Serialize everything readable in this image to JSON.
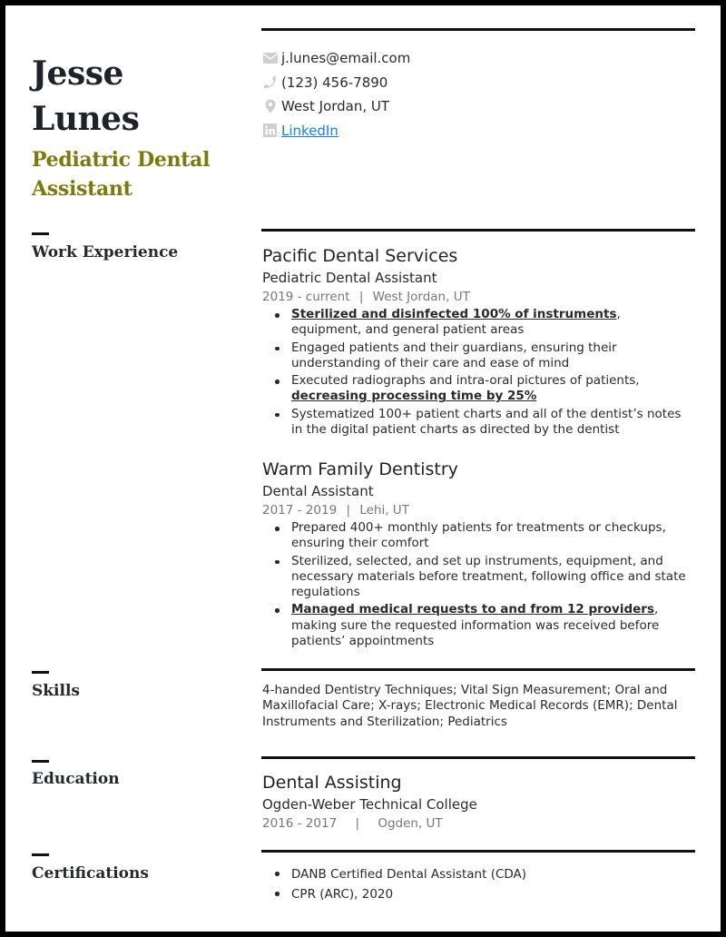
{
  "header": {
    "first_name": "Jesse",
    "last_name": "Lunes",
    "title_line1": "Pediatric Dental",
    "title_line2": "Assistant",
    "accent_color": "#7c7a0f"
  },
  "contact": {
    "email": "j.lunes@email.com",
    "phone": "(123) 456-7890",
    "location": "West Jordan, UT",
    "linkedin_label": "LinkedIn",
    "icons": [
      "envelope-icon",
      "phone-icon",
      "map-pin-icon",
      "linkedin-icon"
    ]
  },
  "sections": {
    "work": "Work Experience",
    "skills": "Skills",
    "education": "Education",
    "certifications": "Certifications"
  },
  "work": [
    {
      "company": "Pacific Dental Services",
      "role": "Pediatric Dental Assistant",
      "dates": "2019 - current",
      "location": "West Jordan, UT",
      "bullets": [
        {
          "highlight": "Sterilized and disinfected 100% of instruments",
          "text": ", equipment, and general patient areas"
        },
        {
          "pre": "Engaged patients and their guardians, ensuring their understanding of their care and ease of mind"
        },
        {
          "pre": "Executed radiographs and intra-oral pictures of patients, ",
          "highlight": "decreasing processing time by 25%"
        },
        {
          "pre": "Systematized 100+ patient charts and all of the dentist’s notes in the digital patient charts as directed by the dentist"
        }
      ]
    },
    {
      "company": "Warm Family Dentistry",
      "role": "Dental Assistant",
      "dates": "2017 - 2019",
      "location": "Lehi, UT",
      "bullets": [
        {
          "pre": "Prepared 400+ monthly patients for treatments or checkups, ensuring their comfort"
        },
        {
          "pre": "Sterilized, selected, and set up instruments, equipment, and necessary materials before treatment, following office and state regulations"
        },
        {
          "highlight": "Managed medical requests to and from 12 providers",
          "text": ", making sure the requested information was received before patients’ appointments"
        }
      ]
    }
  ],
  "skills": "4-handed Dentistry Techniques; Vital Sign Measurement; Oral and Maxillofacial Care; X-rays; Electronic Medical Records (EMR); Dental Instruments and Sterilization; Pediatrics",
  "education": {
    "degree": "Dental Assisting",
    "school": "Ogden-Weber Technical College",
    "dates": "2016 - 2017",
    "location": "Ogden, UT"
  },
  "certifications": [
    "DANB Certified Dental Assistant (CDA)",
    "CPR (ARC), 2020"
  ],
  "separator": "|"
}
